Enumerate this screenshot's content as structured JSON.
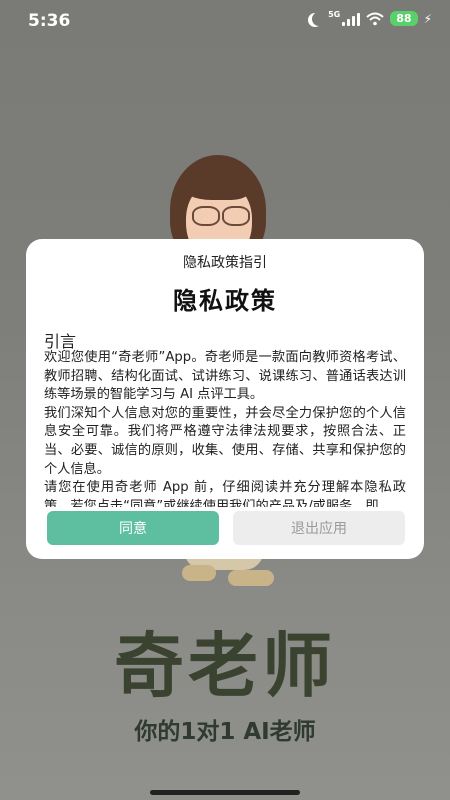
{
  "status_bar": {
    "time": "5:36",
    "network": "5G",
    "battery": "88"
  },
  "background": {
    "brand": "奇老师",
    "slogan": "你的1对1 AI老师"
  },
  "dialog": {
    "small_title": "隐私政策指引",
    "title": "隐私政策",
    "section_heading": "引言",
    "paragraphs": [
      "欢迎您使用“奇老师”App。奇老师是一款面向教师资格考试、教师招聘、结构化面试、试讲练习、说课练习、普通话表达训练等场景的智能学习与 AI 点评工具。",
      "我们深知个人信息对您的重要性，并会尽全力保护您的个人信息安全可靠。我们将严格遵守法律法规要求，按照合法、正当、必要、诚信的原则，收集、使用、存储、共享和保护您的个人信息。",
      "请您在使用奇老师 App 前，仔细阅读并充分理解本隐私政策。若您点击“同意”或继续使用我们的产品及/或服务，即"
    ],
    "agree_label": "同意",
    "exit_label": "退出应用"
  },
  "colors": {
    "agree_button": "#5ebfa0",
    "exit_button": "#ededed",
    "brand_text": "#3a4330",
    "battery": "#59d06a"
  }
}
